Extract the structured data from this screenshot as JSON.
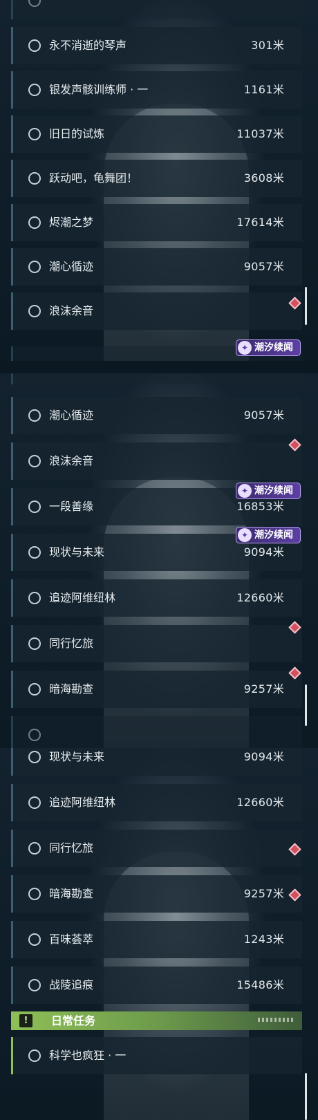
{
  "panel1": {
    "rows": [
      {
        "name": "",
        "dist": ""
      },
      {
        "name": "永不消逝的琴声",
        "dist": "301米"
      },
      {
        "name": "银发声骸训练师 · 一",
        "dist": "1161米"
      },
      {
        "name": "旧日的试炼",
        "dist": "11037米"
      },
      {
        "name": "跃动吧，龟舞团！",
        "dist": "3608米"
      },
      {
        "name": "烬潮之梦",
        "dist": "17614米"
      },
      {
        "name": "潮心循迹",
        "dist": "9057米"
      },
      {
        "name": "浪沫余音",
        "dist": ""
      }
    ]
  },
  "panel2": {
    "rows": [
      {
        "name": "潮心循迹",
        "dist": "9057米"
      },
      {
        "name": "浪沫余音",
        "dist": ""
      },
      {
        "name": "一段善缘",
        "dist": "16853米"
      },
      {
        "name": "现状与未来",
        "dist": "9094米"
      },
      {
        "name": "追迹阿维纽林",
        "dist": "12660米"
      },
      {
        "name": "同行忆旅",
        "dist": ""
      },
      {
        "name": "暗海勘查",
        "dist": "9257米"
      },
      {
        "name": "",
        "dist": ""
      }
    ]
  },
  "panel3": {
    "rows": [
      {
        "name": "现状与未来",
        "dist": "9094米"
      },
      {
        "name": "追迹阿维纽林",
        "dist": "12660米"
      },
      {
        "name": "同行忆旅",
        "dist": ""
      },
      {
        "name": "暗海勘查",
        "dist": "9257米"
      },
      {
        "name": "百味荟萃",
        "dist": "1243米"
      },
      {
        "name": "战陵追痕",
        "dist": "15486米"
      }
    ],
    "section": {
      "title": "日常任务",
      "icon": "!"
    },
    "daily": [
      {
        "name": "科学也疯狂 · 一",
        "dist": ""
      }
    ]
  },
  "tag_label": "潮汐续闻",
  "tag_icon": "✦",
  "colors": {
    "row_bg": "#16242f",
    "accent_line": "#3d5f72",
    "tag_purple": "#5c3fa3",
    "alert_red": "#d5505f",
    "daily_green": "#8fbf57"
  },
  "icons": [
    "status-circle-icon",
    "alert-diamond-icon",
    "tide-sparkle-icon",
    "exclamation-icon"
  ]
}
